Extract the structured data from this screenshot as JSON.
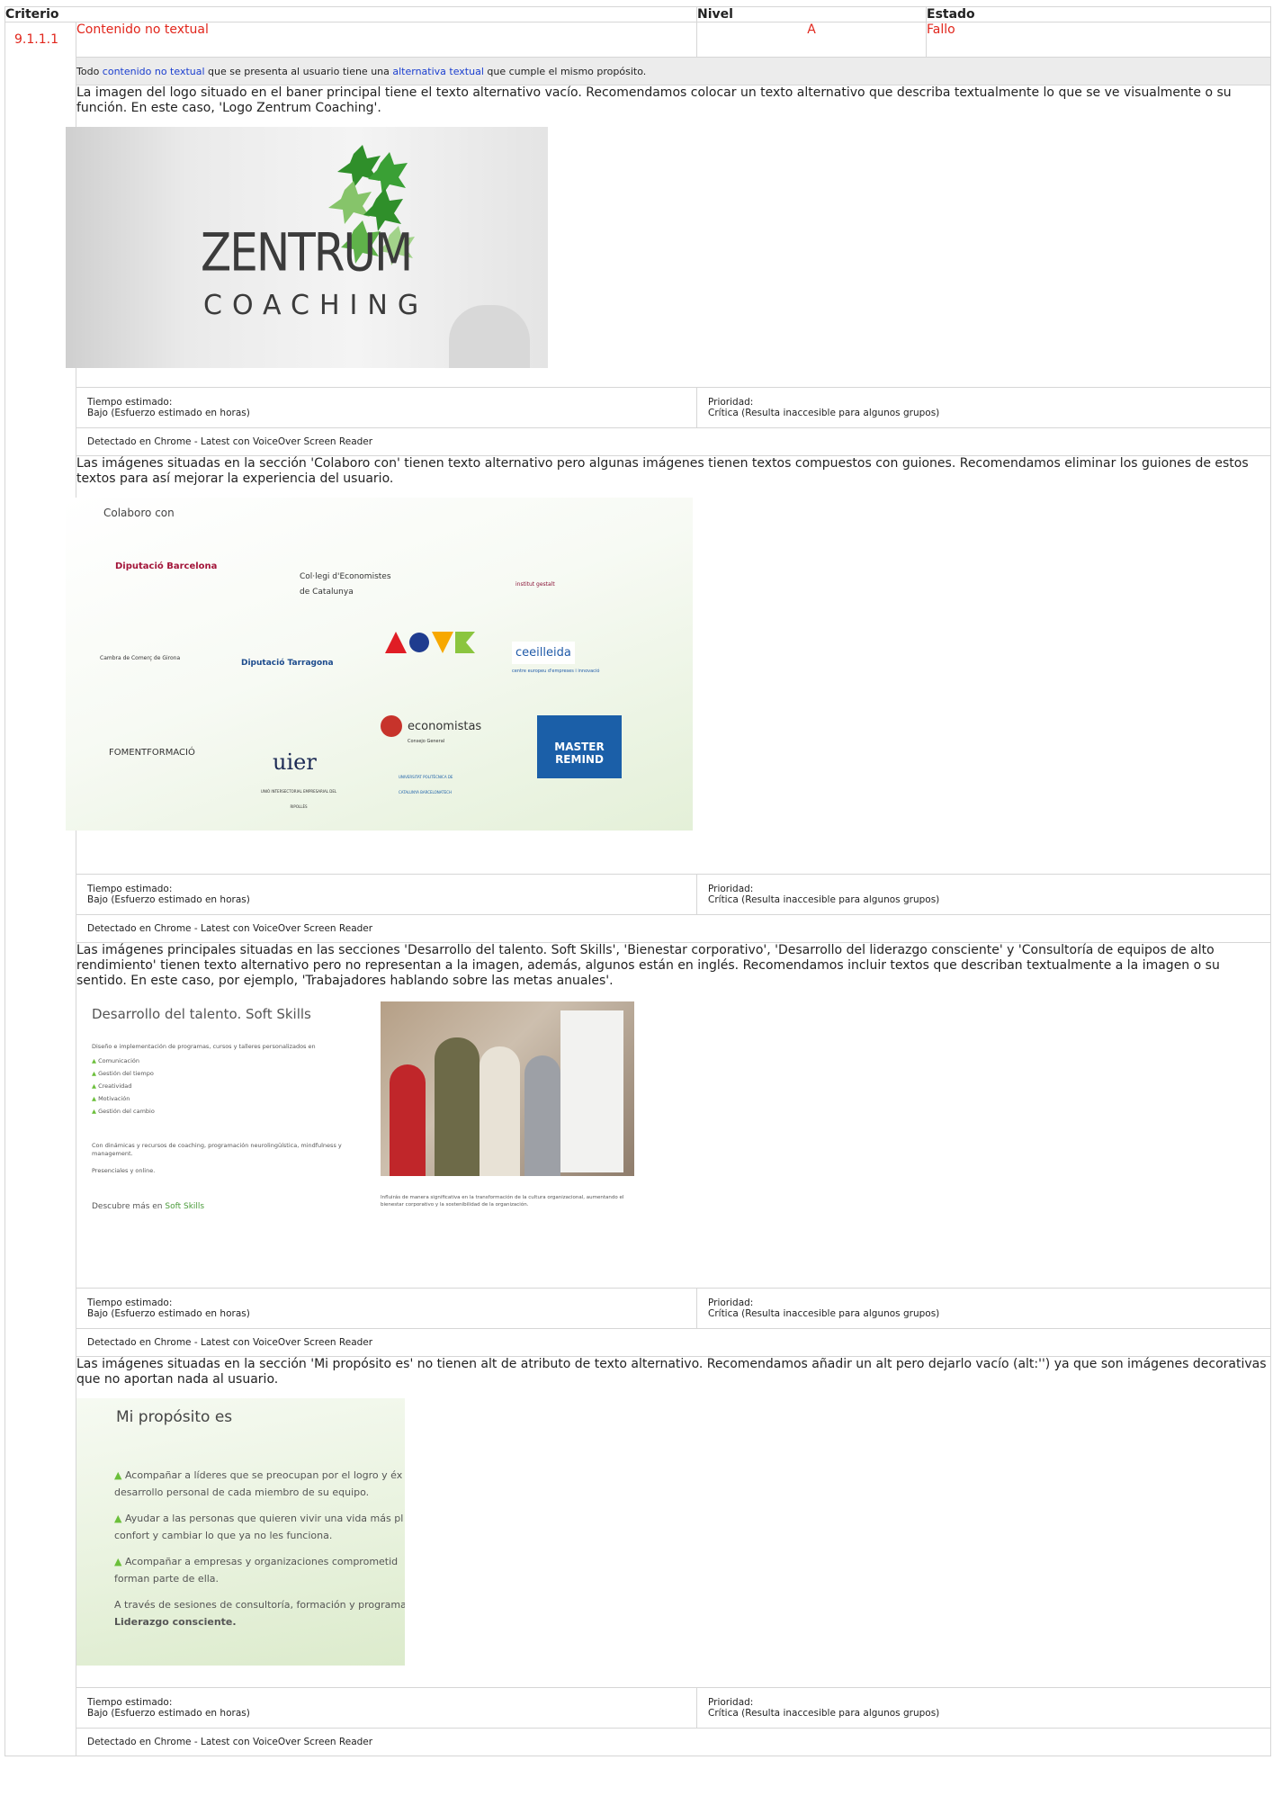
{
  "table": {
    "headers": [
      "Criterio",
      "Nivel",
      "Estado"
    ],
    "criterion": {
      "id": "9.1.1.1",
      "name": "Contenido no textual",
      "level": "A",
      "status": "Fallo",
      "description": {
        "part1": "Todo ",
        "link1": "contenido no textual",
        "part2": " que se presenta al usuario tiene una ",
        "link2": "alternativa textual",
        "part3": " que cumple el mismo propósito."
      }
    }
  },
  "findings": [
    {
      "text": "La imagen del logo situado en el baner principal tiene el texto alternativo vacío. Recomendamos colocar un texto alternativo que describa textualmente lo que se ve visualmente o su función. En este caso, 'Logo Zentrum Coaching'.",
      "time_label": "Tiempo estimado:",
      "time_value": "Bajo (Esfuerzo estimado en horas)",
      "priority_label": "Prioridad:",
      "priority_value": "Crítica (Resulta inaccesible para algunos grupos)",
      "detected": "Detectado en Chrome - Latest con VoiceOver Screen Reader"
    },
    {
      "text": "Las imágenes situadas en la sección 'Colaboro con' tienen texto alternativo pero algunas imágenes tienen textos compuestos con guiones. Recomendamos eliminar los guiones de estos textos para así mejorar la experiencia del usuario.",
      "time_label": "Tiempo estimado:",
      "time_value": "Bajo (Esfuerzo estimado en horas)",
      "priority_label": "Prioridad:",
      "priority_value": "Crítica (Resulta inaccesible para algunos grupos)",
      "detected": "Detectado en Chrome - Latest con VoiceOver Screen Reader"
    },
    {
      "text": "Las imágenes principales situadas en las secciones 'Desarrollo del talento. Soft Skills', 'Bienestar corporativo', 'Desarrollo del liderazgo consciente' y 'Consultoría de equipos de alto rendimiento' tienen texto alternativo pero no representan a la imagen, además, algunos están en inglés. Recomendamos incluir textos que describan textualmente a la imagen o su sentido. En este caso, por ejemplo, 'Trabajadores hablando sobre las metas anuales'.",
      "time_label": "Tiempo estimado:",
      "time_value": "Bajo (Esfuerzo estimado en horas)",
      "priority_label": "Prioridad:",
      "priority_value": "Crítica (Resulta inaccesible para algunos grupos)",
      "detected": "Detectado en Chrome - Latest con VoiceOver Screen Reader"
    },
    {
      "text": "Las imágenes situadas en la sección 'Mi propósito es' no tienen alt de atributo de texto alternativo. Recomendamos añadir un alt pero dejarlo vacío (alt:'') ya que son imágenes decorativas que no aportan nada al usuario.",
      "time_label": "Tiempo estimado:",
      "time_value": "Bajo (Esfuerzo estimado en horas)",
      "priority_label": "Prioridad:",
      "priority_value": "Crítica (Resulta inaccesible para algunos grupos)",
      "detected": "Detectado en Chrome - Latest con VoiceOver Screen Reader"
    }
  ],
  "screenshots": {
    "zentrum": {
      "line1": "ZENTRUM",
      "line2": "COACHING"
    },
    "colaboro": {
      "heading": "Colaboro con",
      "logos": [
        "Diputació Barcelona",
        "Col·legi d'Economistes de Catalunya",
        "institut gestalt",
        "Cambra de Comerç de Girona",
        "Diputació Tarragona",
        "ceeilleida",
        "centre europeu d'empreses i innovació",
        "FOMENTFORMACIÓ",
        "economistas",
        "Consejo General",
        "MASTER",
        "REMIND",
        "uier",
        "UNIÓ INTERSECTORIAL EMPRESARIAL DEL RIPOLLÈS",
        "UNIVERSITAT POLITÈCNICA DE CATALUNYA BARCELONATECH"
      ]
    },
    "desarrollo": {
      "heading": "Desarrollo del talento. Soft Skills",
      "intro": "Diseño e implementación de programas, cursos y talleres personalizados en",
      "items": [
        "Comunicación",
        "Gestión del tiempo",
        "Creatividad",
        "Motivación",
        "Gestión del cambio"
      ],
      "para": "Con dinámicas y recursos de coaching, programación neurolingüística, mindfulness y management.",
      "modes": "Presenciales y online.",
      "more_prefix": "Descubre más en ",
      "more_link": "Soft Skills",
      "caption": "Influirás de manera significativa en la transformación de la cultura organizacional, aumentando el bienestar corporativo y la sostenibilidad de la organización."
    },
    "proposito": {
      "heading": "Mi propósito es",
      "lines": [
        "Acompañar a líderes  que se preocupan por el logro y éx",
        "desarrollo personal de cada miembro de su equipo.",
        "Ayudar a las personas que quieren vivir una vida más pl",
        "confort y cambiar lo que ya no les funciona.",
        "Acompañar a empresas y organizaciones comprometid",
        "forman parte de ella.",
        "A través de sesiones de consultoría, formación y programas",
        "Liderazgo consciente."
      ]
    }
  }
}
